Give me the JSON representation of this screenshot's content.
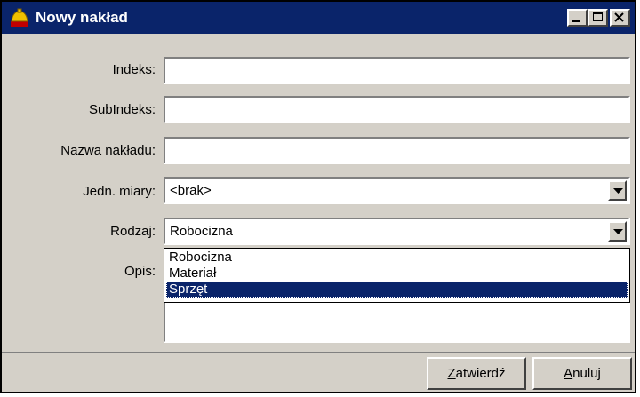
{
  "window": {
    "title": "Nowy nakład",
    "controls": {
      "minimize_icon": "minimize-icon",
      "maximize_icon": "maximize-icon",
      "close_icon": "close-icon"
    }
  },
  "form": {
    "indeks": {
      "label": "Indeks:",
      "value": ""
    },
    "subindeks": {
      "label": "SubIndeks:",
      "value": ""
    },
    "nazwa": {
      "label": "Nazwa nakładu:",
      "value": ""
    },
    "jednostka": {
      "label": "Jedn. miary:",
      "value": "<brak>"
    },
    "rodzaj": {
      "label": "Rodzaj:",
      "value": "Robocizna",
      "options": [
        "Robocizna",
        "Materiał",
        "Sprzęt"
      ],
      "highlighted": "Sprzęt"
    },
    "opis": {
      "label": "Opis:",
      "value": ""
    }
  },
  "buttons": {
    "confirm": {
      "accel": "Z",
      "rest": "atwierdź"
    },
    "cancel": {
      "accel": "A",
      "rest": "nuluj"
    }
  },
  "colors": {
    "titlebar": "#0a246a",
    "face": "#d4d0c8",
    "selection": "#0a246a"
  }
}
